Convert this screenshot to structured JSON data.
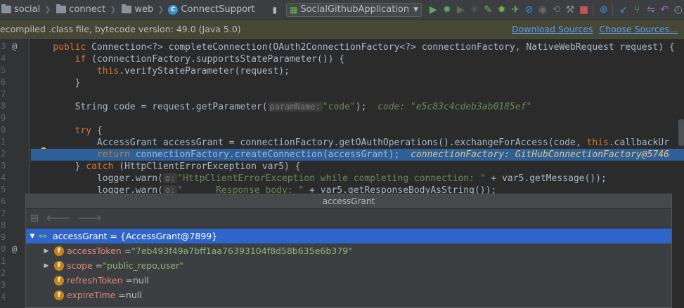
{
  "toolbar": {
    "breadcrumbs": [
      "social",
      "connect",
      "web",
      "ConnectSupport"
    ],
    "run_config": "SocialGithubApplication"
  },
  "infobar": {
    "message": "ecompiled .class file, bytecode version: 49.0 (Java 5.0)",
    "download_sources": "Download Sources",
    "choose_sources": "Choose Sources..."
  },
  "gutter": {
    "numbers": [
      "3",
      "4",
      "5",
      "6",
      "7",
      "8",
      "9",
      "0",
      "1",
      "2",
      "3",
      "4",
      "5",
      "6",
      "7",
      "8",
      "9",
      "0",
      "1",
      "2",
      "3",
      "4"
    ],
    "at_marks": [
      "@",
      "@"
    ]
  },
  "code": {
    "l1": {
      "kw": "public",
      "rest": " Connection<?> completeConnection(OAuth2ConnectionFactory<?> connectionFactory, NativeWebRequest request) {"
    },
    "l2": {
      "kw": "if",
      "rest": " (connectionFactory.supportsStateParameter()) {"
    },
    "l3": {
      "kw": "this",
      "rest": ".verifyStateParameter(request);"
    },
    "l4": {
      "text": "}"
    },
    "l6": {
      "pre": "String code = request.getParameter(",
      "hint": "paramName:",
      "str": "\"code\"",
      "post": ");",
      "dbg": "code: \"e5c83c4cdeb3ab0185ef\""
    },
    "l8": {
      "kw": "try",
      "rest": " {"
    },
    "l9": {
      "pre": "AccessGrant accessGrant = connectionFactory.getOAuthOperations().exchangeForAccess(code, ",
      "kw": "this",
      "post": ".callbackUr"
    },
    "l10": {
      "kw": "return",
      "rest": " connectionFactory.createConnection(accessGrant);",
      "dbg": "connectionFactory: GitHubConnectionFactory@5746"
    },
    "l11": {
      "pre": "} ",
      "kw": "catch",
      "rest": " (HttpClientErrorException var5) {"
    },
    "l12": {
      "pre": "logger.warn(",
      "hint": "o:",
      "str": "\"HttpClientErrorException while completing connection: \"",
      "post": " + var5.getMessage());"
    },
    "l13": {
      "pre": "logger.warn(",
      "hint": "o:",
      "str": "\"      Response body: \"",
      "post": " + var5.getResponseBodyAsString());"
    }
  },
  "popup": {
    "title": "accessGrant",
    "root": {
      "name": "accessGrant",
      "value": "= {AccessGrant@7899}"
    },
    "fields": [
      {
        "name": "accessToken",
        "eq": "= ",
        "value": "\"7eb493f49a7bff1aa76393104f8d58b635e6b379\"",
        "expandable": true,
        "is_string": true
      },
      {
        "name": "scope",
        "eq": "= ",
        "value": "\"public_repo,user\"",
        "expandable": true,
        "is_string": true
      },
      {
        "name": "refreshToken",
        "eq": "= ",
        "value": "null",
        "expandable": false,
        "is_string": false
      },
      {
        "name": "expireTime",
        "eq": "= ",
        "value": "null",
        "expandable": false,
        "is_string": false
      }
    ]
  },
  "colors": {
    "keyword": "#cc7832",
    "string": "#6a8759",
    "selection": "#2d6099",
    "link": "#589df6"
  }
}
